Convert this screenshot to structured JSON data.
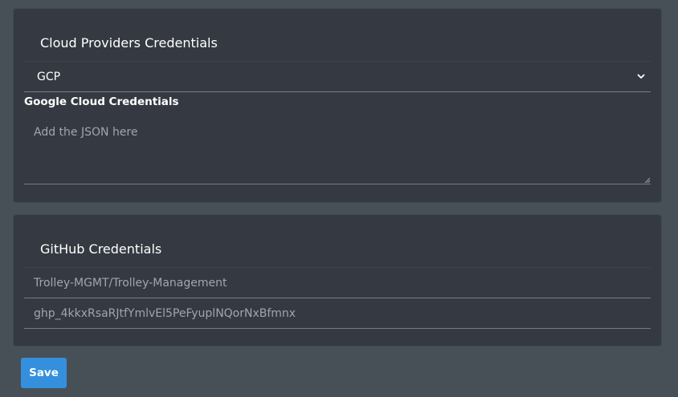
{
  "cloud_section": {
    "title": "Cloud Providers Credentials",
    "provider_select": {
      "selected": "GCP",
      "icon": "chevron-down-icon"
    },
    "credentials_label": "Google Cloud Credentials",
    "credentials_textarea": {
      "value": "",
      "placeholder": "Add the JSON here"
    }
  },
  "github_section": {
    "title": "GitHub Credentials",
    "repository_input": {
      "value": "",
      "placeholder": "Trolley-MGMT/Trolley-Management"
    },
    "token_input": {
      "value": "",
      "placeholder": "ghp_4kkxRsaRJtfYmlvEl5PeFyuplNQorNxBfmnx"
    }
  },
  "actions": {
    "save_label": "Save"
  },
  "colors": {
    "page_background": "#474f57",
    "card_background": "#353a42",
    "primary_button": "#3490dc",
    "input_border": "#767d86",
    "placeholder_text": "#a0a6ad"
  }
}
